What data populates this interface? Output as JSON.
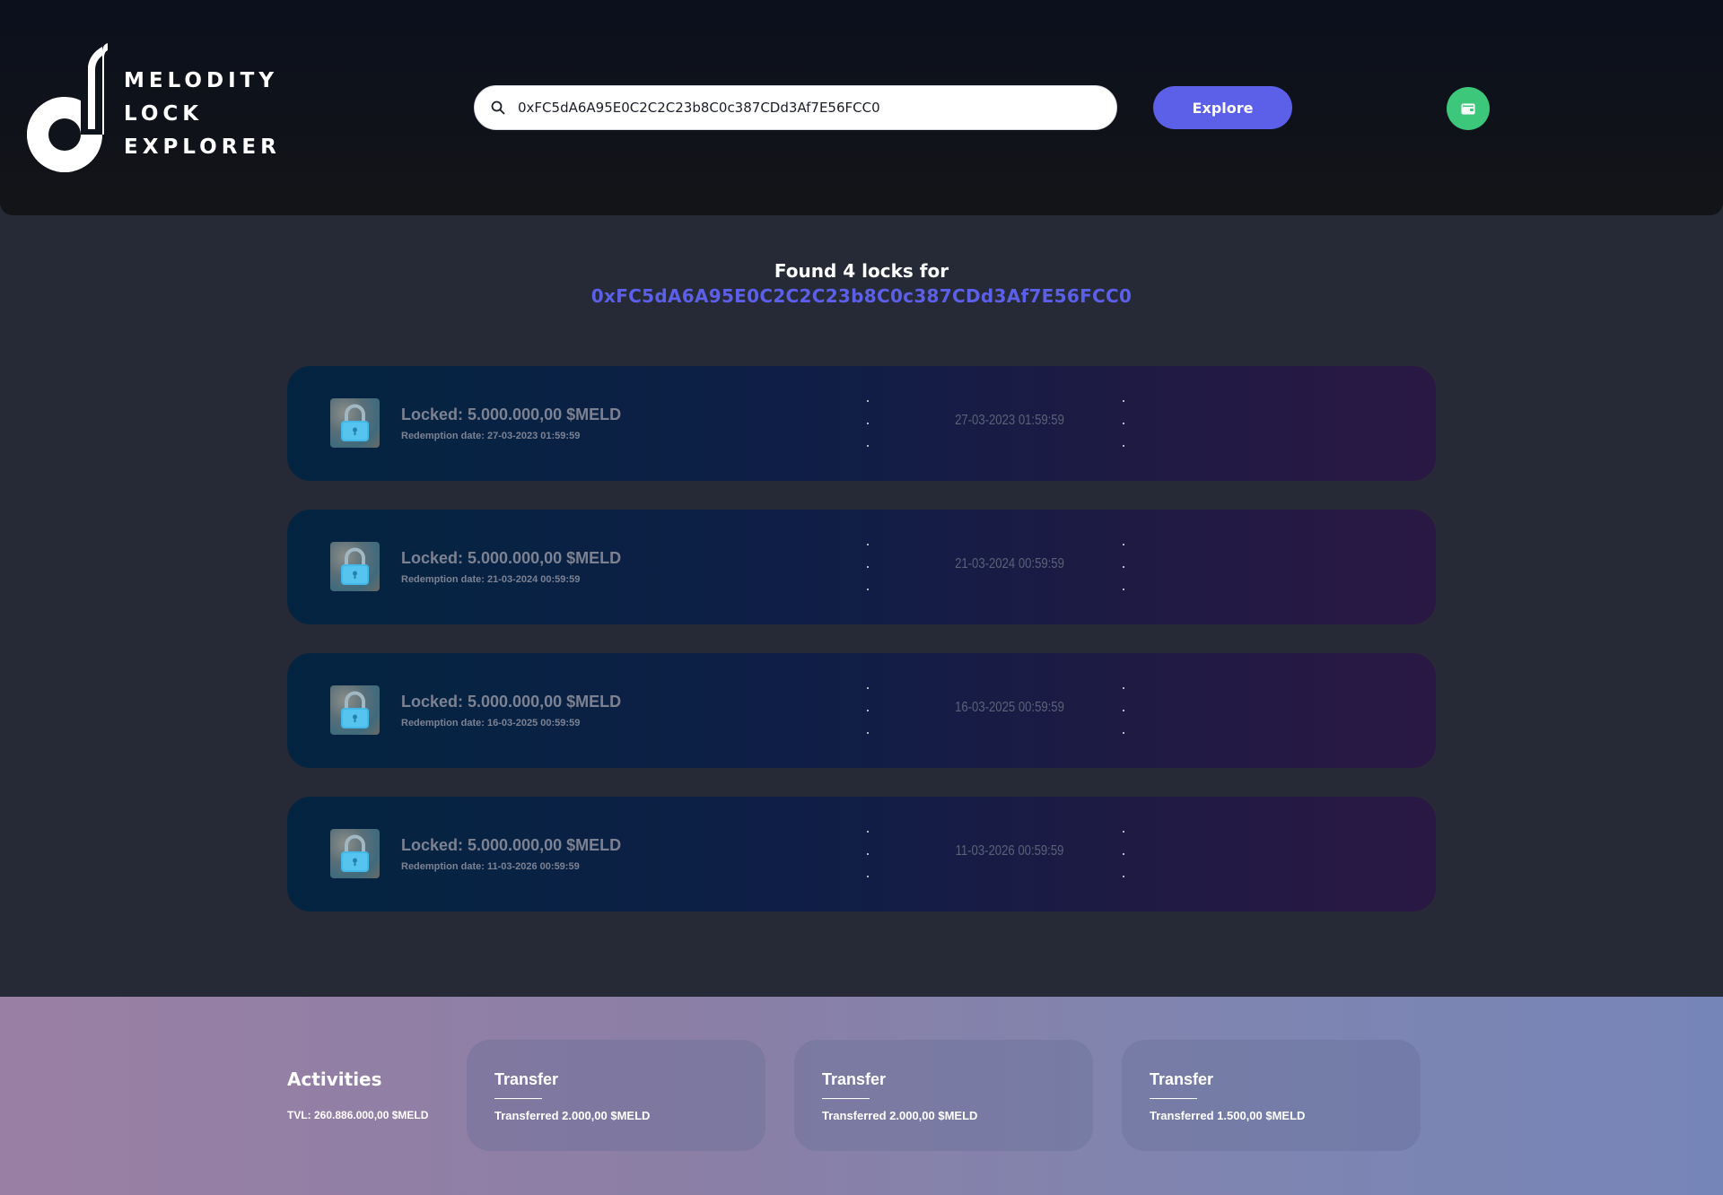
{
  "header": {
    "logo_lines": [
      "MELODITY",
      "LOCK",
      "EXPLORER"
    ],
    "search": {
      "value": "0xFC5dA6A95E0C2C2C23b8C0c387CDd3Af7E56FCC0",
      "placeholder": ""
    },
    "explore_label": "Explore",
    "wallet_icon": "wallet-icon"
  },
  "results": {
    "found_text": "Found 4 locks for",
    "address": "0xFC5dA6A95E0C2C2C23b8C0c387CDd3Af7E56FCC0"
  },
  "locks": [
    {
      "title": "Locked: 5.000.000,00 $MELD",
      "subtitle": "Redemption date: 27-03-2023 01:59:59",
      "date": "27-03-2023 01:59:59"
    },
    {
      "title": "Locked: 5.000.000,00 $MELD",
      "subtitle": "Redemption date: 21-03-2024 00:59:59",
      "date": "21-03-2024 00:59:59"
    },
    {
      "title": "Locked: 5.000.000,00 $MELD",
      "subtitle": "Redemption date: 16-03-2025 00:59:59",
      "date": "16-03-2025 00:59:59"
    },
    {
      "title": "Locked: 5.000.000,00 $MELD",
      "subtitle": "Redemption date: 11-03-2026 00:59:59",
      "date": "11-03-2026 00:59:59"
    }
  ],
  "footer": {
    "title": "Activities",
    "tvl": "TVL: 260.886.000,00 $MELD",
    "activities": [
      {
        "title": "Transfer",
        "desc": "Transferred 2.000,00 $MELD"
      },
      {
        "title": "Transfer",
        "desc": "Transferred 2.000,00 $MELD"
      },
      {
        "title": "Transfer",
        "desc": "Transferred 1.500,00 $MELD"
      }
    ]
  },
  "colors": {
    "accent": "#5c5fe8",
    "wallet_green": "#3cc77a",
    "background": "#252a36",
    "header_bg": "#0b101c"
  }
}
